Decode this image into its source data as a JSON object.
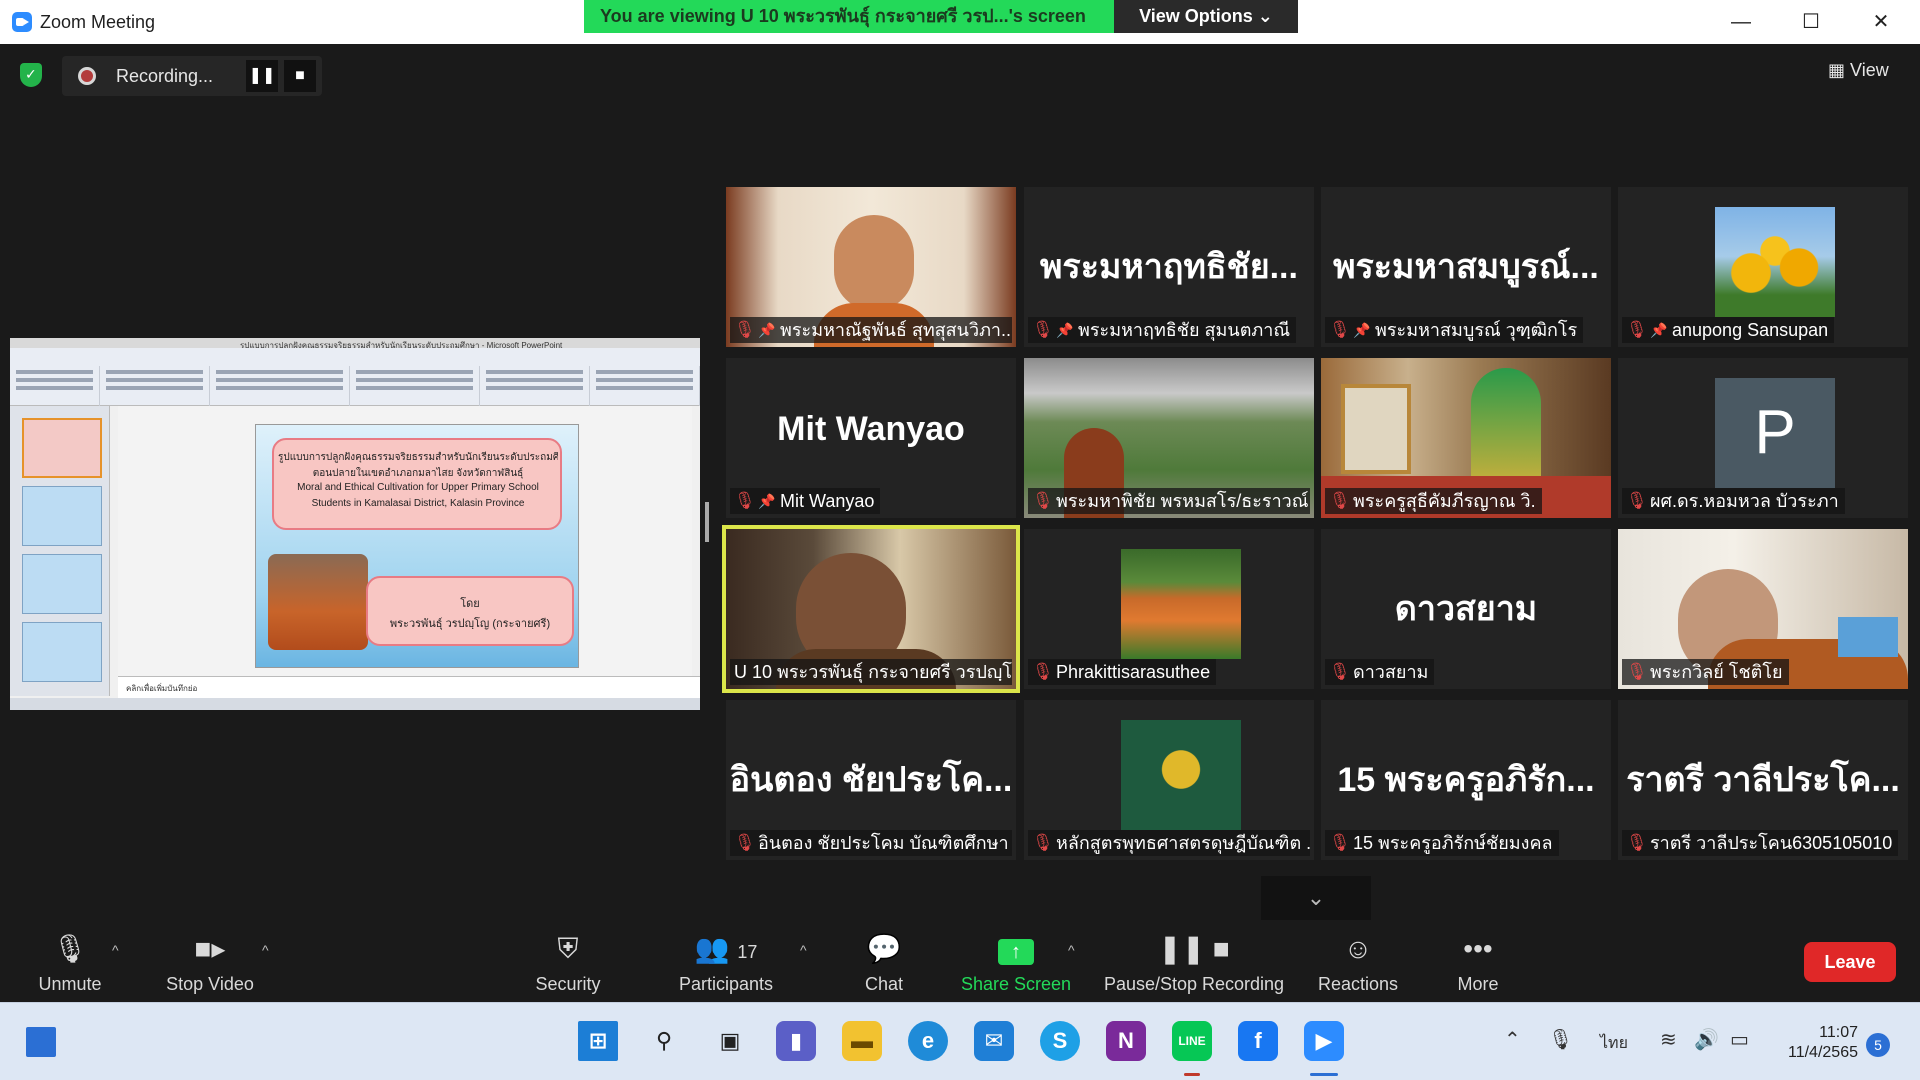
{
  "window": {
    "title": "Zoom Meeting"
  },
  "banner": {
    "viewing_text": "You are viewing U 10 พระวรพันธุ์ กระจายศรี วรป...'s screen",
    "view_options": "View Options ⌄"
  },
  "recording": {
    "label": "Recording...",
    "pause": "❚❚",
    "stop": "■"
  },
  "view_button": "View",
  "shared_slide": {
    "window_title": "รูปแบบการปลูกฝังคุณธรรมจริยธรรมสำหรับนักเรียนระดับประถมศึกษา - Microsoft PowerPoint",
    "line1": "รูปแบบการปลูกฝังคุณธรรมจริยธรรมสำหรับนักเรียนระดับประถมศึกษา",
    "line2": "ตอนปลายในเขตอำเภอกมลาไสย จังหวัดกาฬสินธุ์",
    "line3": "Moral and Ethical Cultivation for Upper Primary School",
    "line4": "Students in Kamalasai District, Kalasin Province",
    "by": "โดย",
    "author": "พระวรพันธุ์ วรปญฺโญ (กระจายศรี)",
    "notes": "คลิกเพื่อเพิ่มบันทึกย่อ"
  },
  "participants": [
    {
      "label": "พระมหาณัฐพันธ์ สุทสุสนวิภา...",
      "muted": true,
      "pinned": true,
      "display": "video"
    },
    {
      "label": "พระมหาฤทธิชัย สุมนตภาณี",
      "big": "พระมหาฤทธิชัย...",
      "muted": true,
      "pinned": true,
      "display": "name"
    },
    {
      "label": "พระมหาสมบูรณ์ วุฑฺฒิกโร",
      "big": "พระมหาสมบูรณ์...",
      "muted": true,
      "pinned": true,
      "display": "name"
    },
    {
      "label": "anupong Sansupan",
      "muted": true,
      "pinned": true,
      "display": "avatar-tulip"
    },
    {
      "label": "Mit Wanyao",
      "big": "Mit Wanyao",
      "muted": true,
      "pinned": true,
      "display": "name"
    },
    {
      "label": "พระมหาพิชัย พรหมสโร/ธะราวณ์...",
      "muted": true,
      "pinned": false,
      "display": "video"
    },
    {
      "label": "พระครูสุธีคัมภีรญาณ วิ.",
      "muted": true,
      "pinned": false,
      "display": "video"
    },
    {
      "label": "ผศ.ดร.หอมหวล บัวระภา",
      "big": "P",
      "muted": true,
      "pinned": false,
      "display": "avatar-letter"
    },
    {
      "label": "U 10 พระวรพันธุ์ กระจายศรี วรปญฺโญ",
      "muted": false,
      "pinned": false,
      "display": "video"
    },
    {
      "label": "Phrakittisarasuthee",
      "muted": true,
      "pinned": false,
      "display": "avatar-sign"
    },
    {
      "label": "ดาวสยาม",
      "big": "ดาวสยาม",
      "muted": true,
      "pinned": false,
      "display": "name"
    },
    {
      "label": "พระกวิลย์ โชติโย",
      "muted": true,
      "pinned": false,
      "display": "video"
    },
    {
      "label": "อินตอง ชัยประโคม บัณฑิตศึกษา ...",
      "big": "อินตอง ชัยประโค...",
      "muted": true,
      "pinned": false,
      "display": "name"
    },
    {
      "label": "หลักสูตรพุทธศาสตรดุษฎีบัณฑิต ...",
      "muted": true,
      "pinned": false,
      "display": "avatar-emblem"
    },
    {
      "label": "15 พระครูอภิรักษ์ชัยมงคล",
      "big": "15 พระครูอภิรัก...",
      "muted": true,
      "pinned": false,
      "display": "name"
    },
    {
      "label": "ราตรี วาลีประโคน6305105010",
      "big": "ราตรี วาลีประโค...",
      "muted": true,
      "pinned": false,
      "display": "name"
    }
  ],
  "toolbar": {
    "unmute": "Unmute",
    "stop_video": "Stop Video",
    "security": "Security",
    "participants": "Participants",
    "participants_count": "17",
    "chat": "Chat",
    "share_screen": "Share Screen",
    "pause_stop_recording": "Pause/Stop Recording",
    "reactions": "Reactions",
    "more": "More",
    "leave": "Leave"
  },
  "taskbar": {
    "language": "ไทย",
    "time": "11:07",
    "date": "11/4/2565",
    "notifications": "5",
    "line_label": "LINE"
  },
  "colors": {
    "accent_green": "#23d959",
    "leave_red": "#e02828",
    "active_speaker": "#dce64a"
  }
}
